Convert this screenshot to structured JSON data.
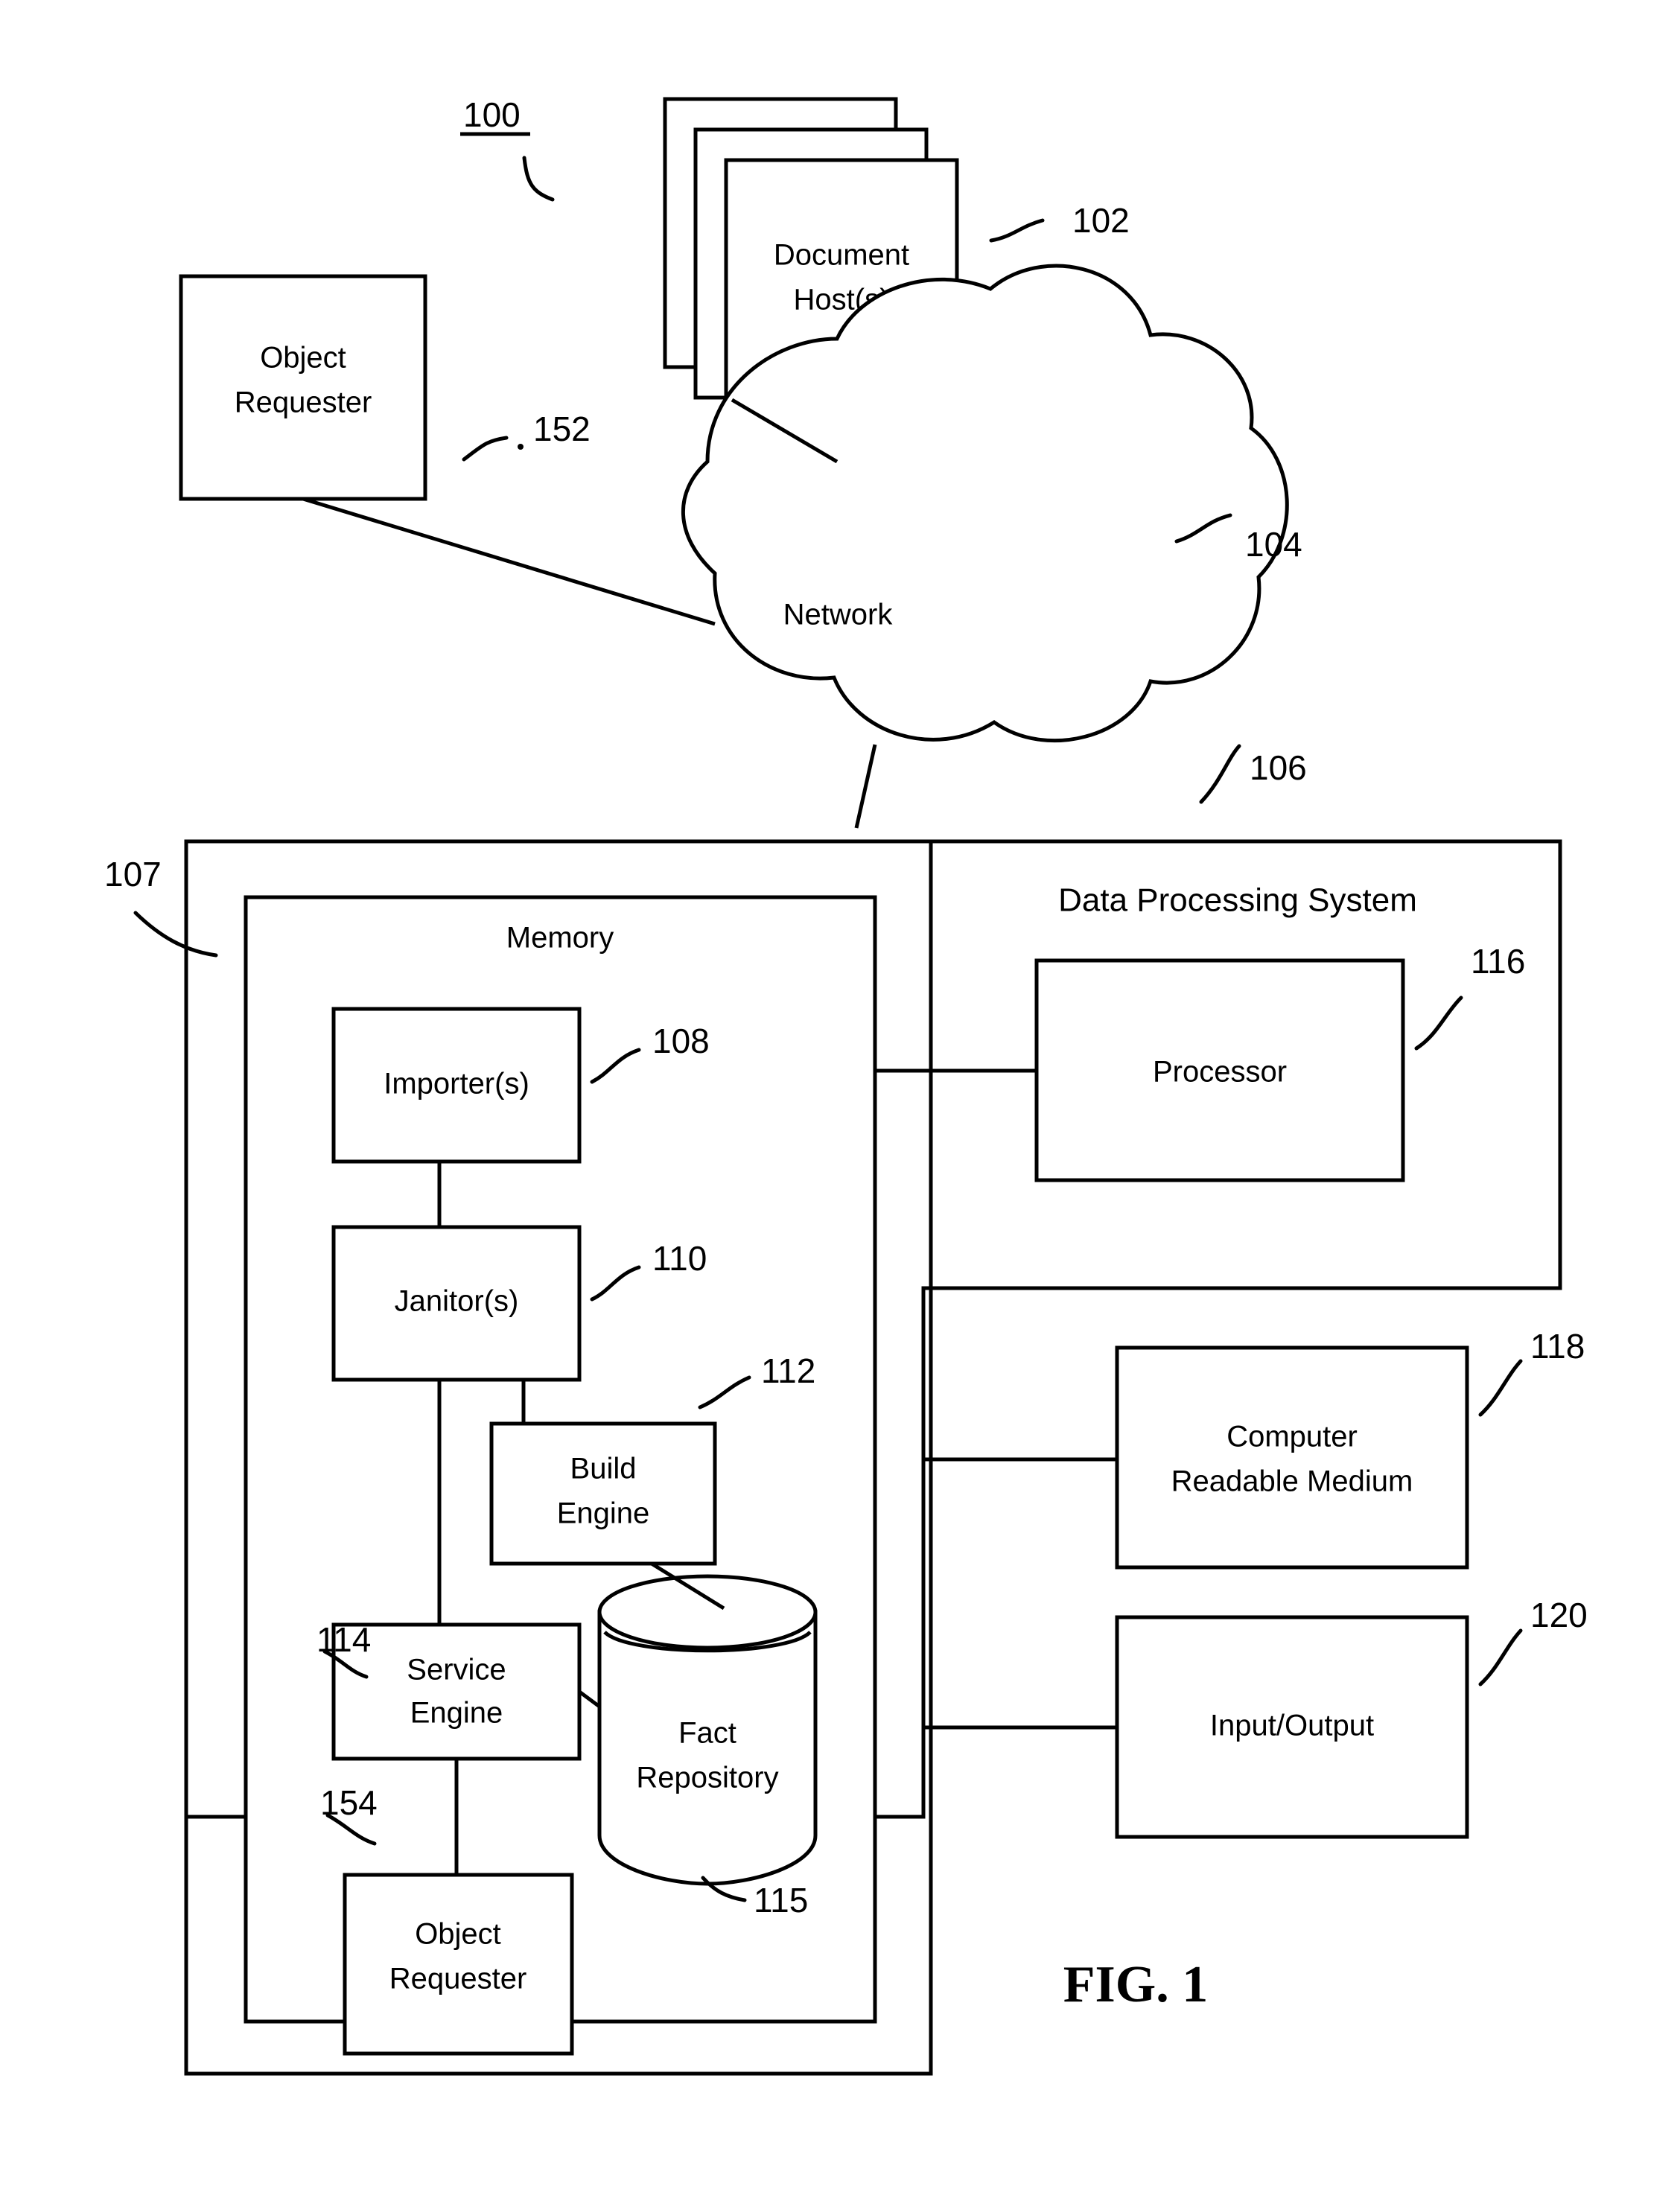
{
  "figure": {
    "caption": "FIG. 1",
    "system_ref": "100"
  },
  "nodes": {
    "object_requester_external": {
      "label_line1": "Object",
      "label_line2": "Requester",
      "ref": "152"
    },
    "document_hosts": {
      "label_line1": "Document",
      "label_line2": "Host(s)",
      "ref": "102"
    },
    "network": {
      "label": "Network",
      "ref": "104"
    },
    "data_processing_system": {
      "label": "Data Processing System",
      "ref": "106"
    },
    "inner_container": {
      "ref": "107"
    },
    "memory": {
      "label": "Memory"
    },
    "importers": {
      "label": "Importer(s)",
      "ref": "108"
    },
    "janitors": {
      "label": "Janitor(s)",
      "ref": "110"
    },
    "build_engine": {
      "label_line1": "Build",
      "label_line2": "Engine",
      "ref": "112"
    },
    "service_engine": {
      "label_line1": "Service",
      "label_line2": "Engine",
      "ref": "114"
    },
    "fact_repository": {
      "label_line1": "Fact",
      "label_line2": "Repository",
      "ref": "115"
    },
    "object_requester_internal": {
      "label_line1": "Object",
      "label_line2": "Requester",
      "ref": "154"
    },
    "processor": {
      "label": "Processor",
      "ref": "116"
    },
    "computer_readable_medium": {
      "label_line1": "Computer",
      "label_line2": "Readable Medium",
      "ref": "118"
    },
    "input_output": {
      "label": "Input/Output",
      "ref": "120"
    }
  },
  "colors": {
    "stroke": "#000000",
    "background": "#ffffff"
  }
}
